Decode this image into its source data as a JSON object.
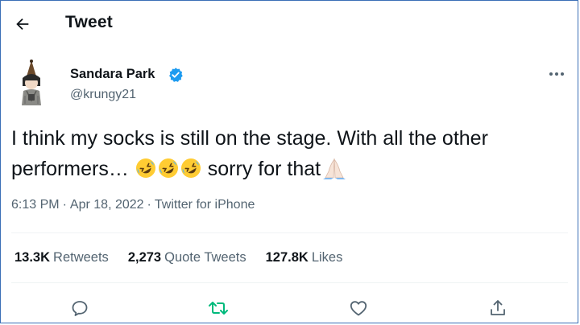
{
  "header": {
    "title": "Tweet"
  },
  "author": {
    "name": "Sandara Park",
    "handle": "@krungy21",
    "verified": true
  },
  "tweet": {
    "text_line1": "I think my socks is still on the stage. With all the other",
    "text_line2_before": "performers…",
    "text_line2_after": "sorry for that",
    "emojis": [
      "rolling-on-floor-laughing-emoji",
      "rolling-on-floor-laughing-emoji",
      "rolling-on-floor-laughing-emoji",
      "folded-hands-emoji"
    ]
  },
  "meta": {
    "time": "6:13 PM",
    "date": "Apr 18, 2022",
    "source": "Twitter for iPhone",
    "separator": "·"
  },
  "stats": {
    "retweets": {
      "value": "13.3K",
      "label": "Retweets"
    },
    "quotes": {
      "value": "2,273",
      "label": "Quote Tweets"
    },
    "likes": {
      "value": "127.8K",
      "label": "Likes"
    }
  },
  "actions": [
    "reply-icon",
    "retweet-icon",
    "like-icon",
    "share-icon"
  ],
  "colors": {
    "text": "#0f1419",
    "secondary": "#536471",
    "verified": "#1d9bf0",
    "retweet": "#00ba7c",
    "divider": "#eff3f4"
  }
}
